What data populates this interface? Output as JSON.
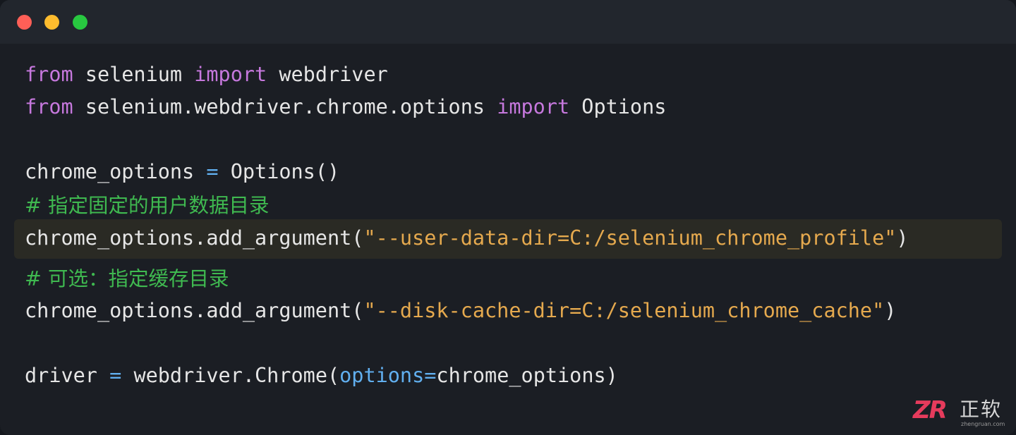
{
  "window": {
    "controls": [
      "close",
      "minimize",
      "zoom"
    ],
    "colors": {
      "close": "#fe5f57",
      "minimize": "#febc2e",
      "zoom": "#28c840"
    }
  },
  "code": {
    "line1": {
      "kw1": "from",
      "mod": " selenium ",
      "kw2": "import",
      "name": " webdriver"
    },
    "line2": {
      "kw1": "from",
      "mod": " selenium.webdriver.chrome.options ",
      "kw2": "import",
      "name": " Options"
    },
    "line3": {
      "var": "chrome_options ",
      "op": "=",
      "call": " Options()"
    },
    "line4": {
      "comment": "# 指定固定的用户数据目录"
    },
    "line5": {
      "call": "chrome_options.add_argument(",
      "str": "\"--user-data-dir=C:/selenium_chrome_profile\"",
      "end": ")"
    },
    "line6": {
      "comment": "# 可选：指定缓存目录"
    },
    "line7": {
      "call": "chrome_options.add_argument(",
      "str": "\"--disk-cache-dir=C:/selenium_chrome_cache\"",
      "end": ")"
    },
    "line8": {
      "var": "driver ",
      "op": "=",
      "call": " webdriver.Chrome(",
      "param": "options=",
      "arg": "chrome_options)"
    }
  },
  "logo": {
    "mark": "ZR",
    "name": "正软",
    "url": "zhengruan.com"
  }
}
